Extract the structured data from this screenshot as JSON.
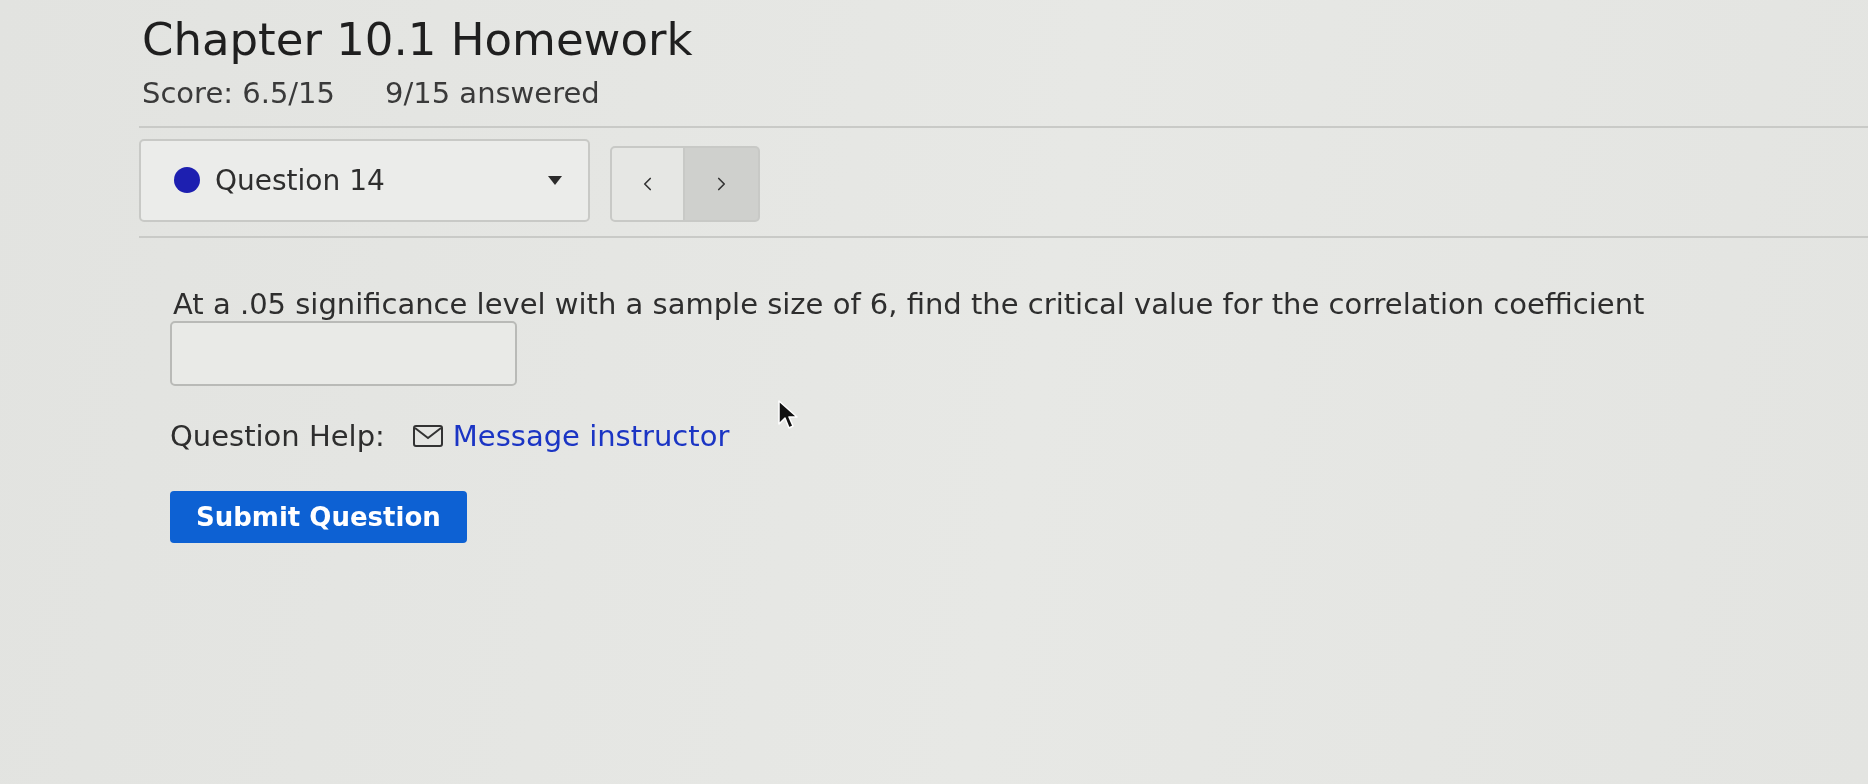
{
  "header": {
    "title": "Chapter 10.1 Homework",
    "score": "Score: 6.5/15",
    "answered": "9/15 answered"
  },
  "question_nav": {
    "dropdown": {
      "label": "Question 14"
    },
    "buttons": [
      {
        "kind": "previous",
        "hovered": false
      },
      {
        "kind": "next",
        "hovered": true
      }
    ]
  },
  "question": {
    "prompt": "At a .05 significance level with a sample size of 6, find the critical value for the correlation coefficient"
  },
  "help": {
    "label": "Question Help:",
    "link": "Message instructor"
  },
  "submit_button": {
    "label": "Submit Question"
  }
}
